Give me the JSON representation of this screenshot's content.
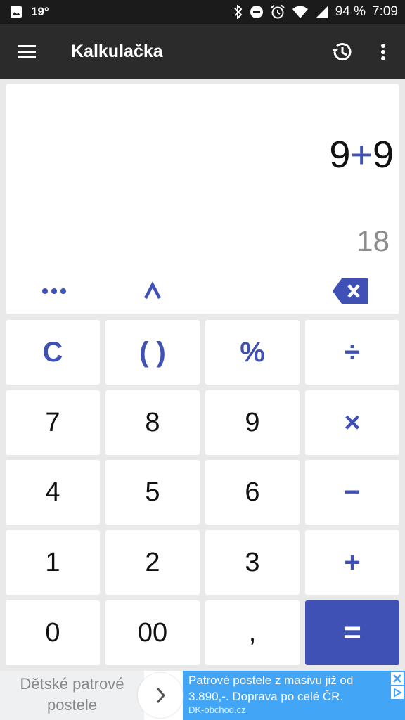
{
  "status_bar": {
    "temperature": "19°",
    "battery": "94 %",
    "time": "7:09"
  },
  "app_bar": {
    "title": "Kalkulačka"
  },
  "display": {
    "expression_left": "9",
    "expression_op": "+",
    "expression_right": "9",
    "result": "18"
  },
  "keypad": {
    "rows": [
      [
        "C",
        "( )",
        "%",
        "÷"
      ],
      [
        "7",
        "8",
        "9",
        "×"
      ],
      [
        "4",
        "5",
        "6",
        "−"
      ],
      [
        "1",
        "2",
        "3",
        "+"
      ],
      [
        "0",
        "00",
        ",",
        "="
      ]
    ]
  },
  "ad": {
    "left_text": "Dětské patrové postele",
    "headline": "Patrové postele z masivu již od 3.890,-. Doprava po celé ČR.",
    "domain": "DK-obchod.cz"
  },
  "colors": {
    "accent": "#3f51b5",
    "app_bar": "#2b2b2b",
    "status_bar": "#1b1b1b",
    "ad_blue": "#42a5f5"
  }
}
